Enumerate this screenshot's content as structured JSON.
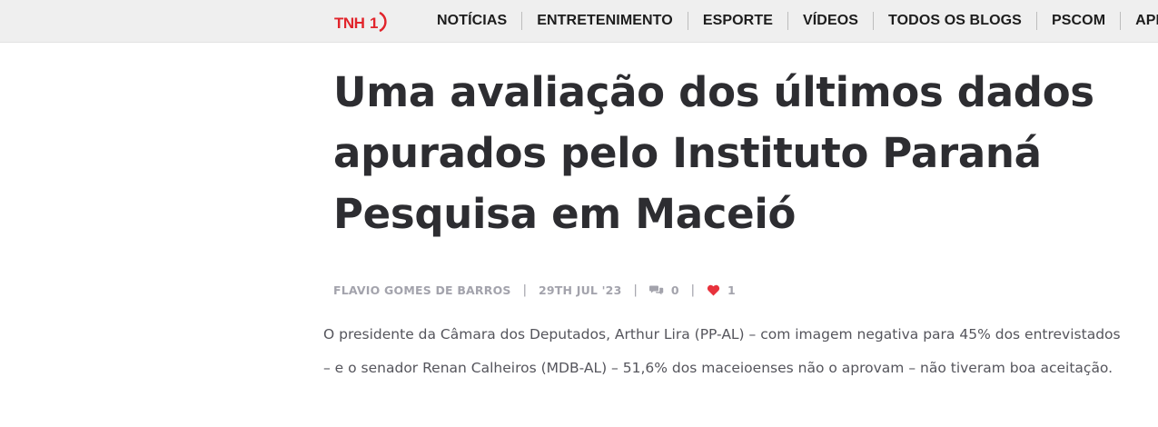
{
  "header": {
    "logo_text": "TNH1",
    "nav": [
      {
        "label": "NOTÍCIAS"
      },
      {
        "label": "ENTRETENIMENTO"
      },
      {
        "label": "ESPORTE"
      },
      {
        "label": "VÍDEOS"
      },
      {
        "label": "TODOS OS BLOGS"
      },
      {
        "label": "PSCOM"
      },
      {
        "label": "APP"
      }
    ]
  },
  "article": {
    "title": "Uma avaliação dos últimos dados apurados pelo Instituto Paraná Pesquisa em Maceió",
    "meta": {
      "author": "FLAVIO GOMES DE BARROS",
      "date": "29TH JUL '23",
      "comments": "0",
      "likes": "1",
      "separator": "|"
    },
    "body": "O presidente da Câmara dos Deputados, Arthur Lira (PP-AL) – com imagem negativa para 45% dos entrevistados – e o senador Renan Calheiros (MDB-AL) – 51,6% dos maceioenses não o aprovam – não tiveram boa aceitação."
  },
  "colors": {
    "brand_red": "#e1242b",
    "heart": "#e8323c",
    "topbar_bg": "#efefef"
  },
  "icons": {
    "comments": "comment-bubbles-icon",
    "likes": "heart-icon"
  }
}
